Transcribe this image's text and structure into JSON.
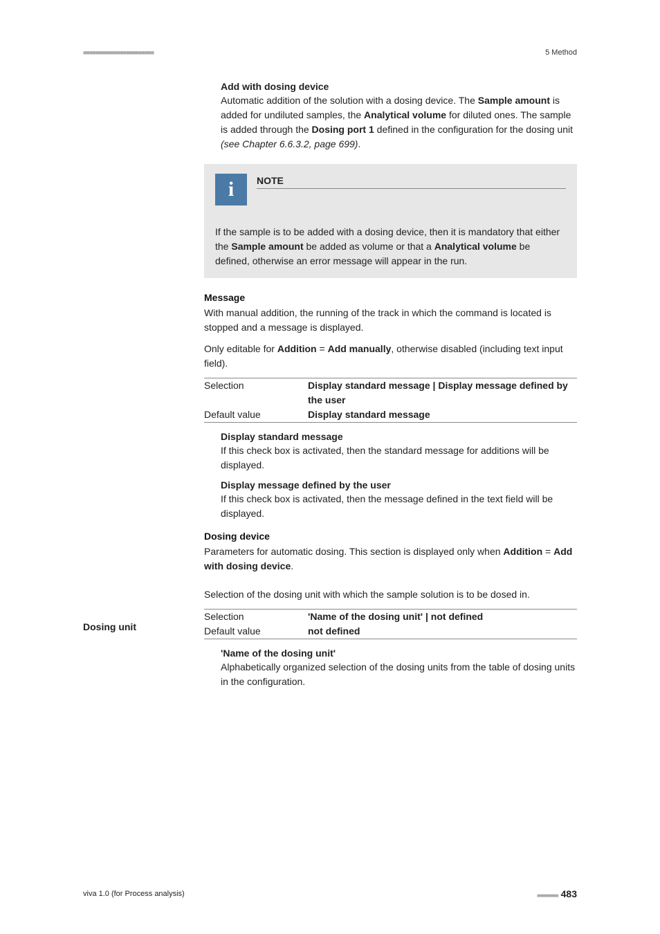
{
  "header": {
    "left_marks": "■■■■■■■■■■■■■■■■■■■■■■■",
    "right": "5 Method"
  },
  "section_add_dosing": {
    "title": "Add with dosing device",
    "para1_pre": "Automatic addition of the solution with a dosing device. The ",
    "para1_b1": "Sample amount",
    "para1_mid1": " is added for undiluted samples, the ",
    "para1_b2": "Analytical volume",
    "para1_mid2": " for diluted ones. The sample is added through the ",
    "para1_b3": "Dosing port 1",
    "para1_mid3": " defined in the configuration for the dosing unit ",
    "para1_italic": "(see Chapter 6.6.3.2, page 699)",
    "para1_end": "."
  },
  "note": {
    "label": "NOTE",
    "text_pre": "If the sample is to be added with a dosing device, then it is mandatory that either the ",
    "text_b1": "Sample amount",
    "text_mid1": " be added as volume or that a ",
    "text_b2": "Analytical volume",
    "text_end": " be defined, otherwise an error message will appear in the run."
  },
  "message": {
    "heading": "Message",
    "para1": "With manual addition, the running of the track in which the command is located is stopped and a message is displayed.",
    "para2_pre": "Only editable for ",
    "para2_b1": "Addition",
    "para2_mid1": " = ",
    "para2_b2": "Add manually",
    "para2_end": ", otherwise disabled (including text input field).",
    "selection_label": "Selection",
    "selection_value": "Display standard message | Display message defined by the user",
    "default_label": "Default value",
    "default_value": "Display standard message",
    "dsm_title": "Display standard message",
    "dsm_text": "If this check box is activated, then the standard message for additions will be displayed.",
    "dmu_title": "Display message defined by the user",
    "dmu_text": "If this check box is activated, then the message defined in the text field will be displayed."
  },
  "dosing_device": {
    "heading": "Dosing device",
    "para_pre": "Parameters for automatic dosing. This section is displayed only when ",
    "para_b1": "Addition",
    "para_mid": " = ",
    "para_b2": "Add with dosing device",
    "para_end": "."
  },
  "dosing_unit": {
    "left_label": "Dosing unit",
    "para": "Selection of the dosing unit with which the sample solution is to be dosed in.",
    "selection_label": "Selection",
    "selection_value": "'Name of the dosing unit' | not defined",
    "default_label": "Default value",
    "default_value": "not defined",
    "name_title": "'Name of the dosing unit'",
    "name_text": "Alphabetically organized selection of the dosing units from the table of dosing units in the configuration."
  },
  "footer": {
    "left": "viva 1.0 (for Process analysis)",
    "marks": "■■■■■■■■",
    "page": "483"
  }
}
